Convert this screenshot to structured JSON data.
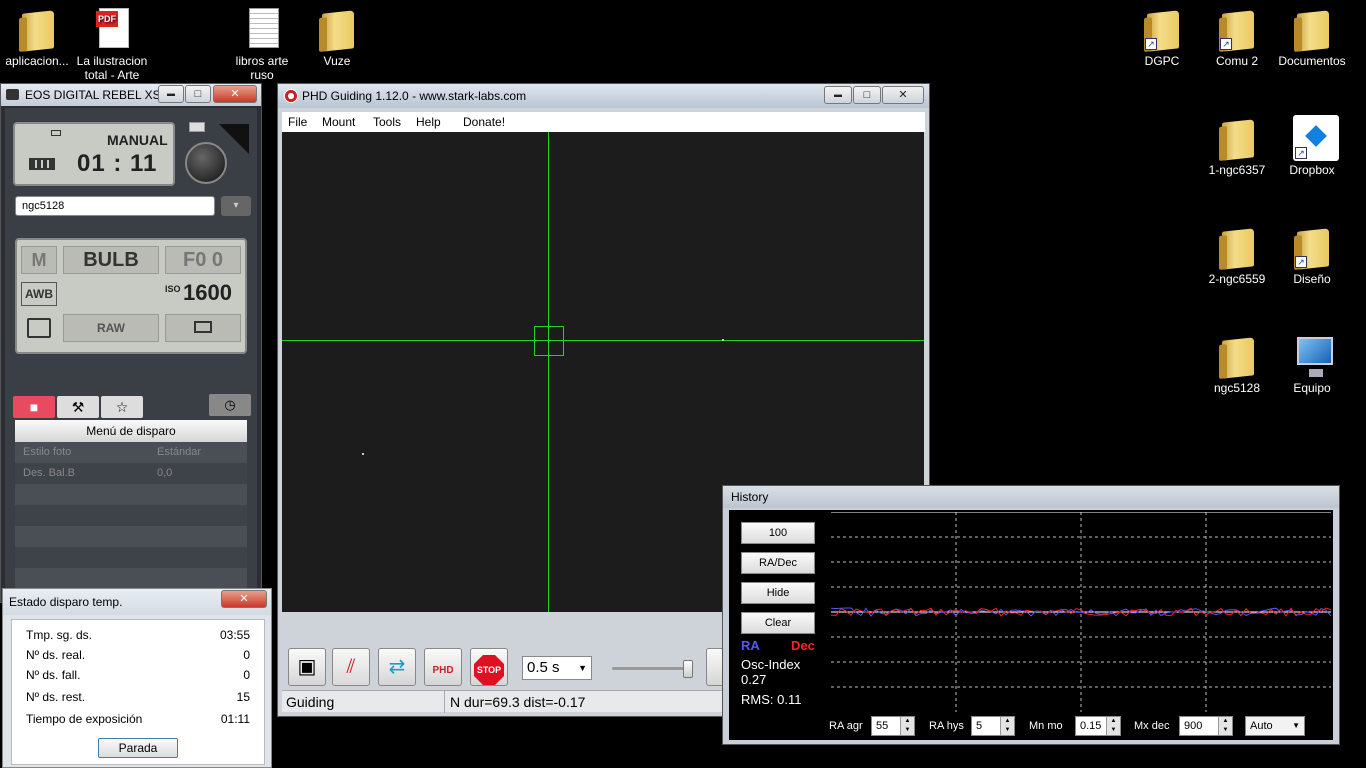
{
  "desktop": {
    "icons": [
      {
        "label": "aplicacion...",
        "kind": "folder"
      },
      {
        "label": "La ilustracion total - Arte",
        "kind": "pdf"
      },
      {
        "label": "libros arte ruso",
        "kind": "text"
      },
      {
        "label": "Vuze",
        "kind": "folder"
      },
      {
        "label": "DGPC",
        "kind": "folder-shortcut"
      },
      {
        "label": "Comu 2",
        "kind": "folder-shortcut"
      },
      {
        "label": "Documentos",
        "kind": "folder"
      },
      {
        "label": "1-ngc6357",
        "kind": "folder"
      },
      {
        "label": "Dropbox",
        "kind": "dropbox-shortcut"
      },
      {
        "label": "2-ngc6559",
        "kind": "folder"
      },
      {
        "label": "Diseño",
        "kind": "folder-shortcut"
      },
      {
        "label": "ngc5128",
        "kind": "folder"
      },
      {
        "label": "Equipo",
        "kind": "computer"
      }
    ]
  },
  "eos": {
    "title": "EOS DIGITAL REBEL XS",
    "mode_label": "MANUAL",
    "time": "01 : 11",
    "folder_field": "ngc5128",
    "shoot_mode": "M",
    "shutter": "BULB",
    "aperture": "F0 0",
    "white_balance": "AWB",
    "iso_label": "ISO",
    "iso": "1600",
    "quality": "RAW",
    "menu_title": "Menú de disparo",
    "rows": [
      {
        "name": "Estilo foto",
        "value": "Estándar"
      },
      {
        "name": "Des. Bal.B",
        "value": "0,0"
      }
    ]
  },
  "status": {
    "title": "Estado disparo temp.",
    "rows": [
      {
        "label": "Tmp. sg. ds.",
        "value": "03:55"
      },
      {
        "label": "Nº ds. real.",
        "value": "0"
      },
      {
        "label": "Nº ds. fall.",
        "value": "0"
      },
      {
        "label": "Nº ds. rest.",
        "value": "15"
      },
      {
        "label": "Tiempo de exposición",
        "value": "01:11"
      }
    ],
    "stop_button": "Parada",
    "close_glyph": "✕"
  },
  "phd": {
    "title": "PHD Guiding 1.12.0  -  www.stark-labs.com",
    "menu": [
      "File",
      "Mount",
      "Tools",
      "Help",
      "Donate!"
    ],
    "exposure": "0.5 s",
    "status_left": "Guiding",
    "status_right": "N dur=69.3 dist=-0.17",
    "stop_label": "STOP",
    "phd_label": "PHD"
  },
  "history": {
    "title": "History",
    "buttons": [
      "100",
      "RA/Dec",
      "Hide",
      "Clear"
    ],
    "ra_label": "RA",
    "dec_label": "Dec",
    "osc_label": "Osc-Index",
    "osc_value": "0.27",
    "rms_label": "RMS: 0.11",
    "controls": [
      {
        "label": "RA agr",
        "value": "55"
      },
      {
        "label": "RA hys",
        "value": "5"
      },
      {
        "label": "Mn mo",
        "value": "0.15"
      },
      {
        "label": "Mx dec",
        "value": "900"
      }
    ],
    "dec_algo": "Auto",
    "colors": {
      "ra": "#5555ff",
      "dec": "#ff2222"
    }
  },
  "win_buttons": {
    "minimize": "▬",
    "maximize": "□",
    "close": "✕"
  }
}
